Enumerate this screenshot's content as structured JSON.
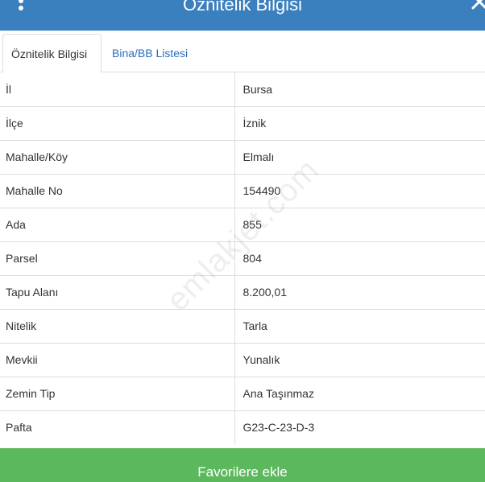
{
  "dialog": {
    "title": "Öznitelik Bilgisi",
    "menu_icon": "vertical-dots-icon",
    "close_icon": "close-icon"
  },
  "tabs": [
    {
      "label": "Öznitelik Bilgisi",
      "active": true
    },
    {
      "label": "Bina/BB Listesi",
      "active": false
    }
  ],
  "attributes": [
    {
      "key": "İl",
      "value": "Bursa"
    },
    {
      "key": "İlçe",
      "value": "İznik"
    },
    {
      "key": "Mahalle/Köy",
      "value": "Elmalı"
    },
    {
      "key": "Mahalle No",
      "value": "154490"
    },
    {
      "key": "Ada",
      "value": "855"
    },
    {
      "key": "Parsel",
      "value": "804"
    },
    {
      "key": "Tapu Alanı",
      "value": "8.200,01"
    },
    {
      "key": "Nitelik",
      "value": "Tarla"
    },
    {
      "key": "Mevkii",
      "value": "Yunalık"
    },
    {
      "key": "Zemin Tip",
      "value": "Ana Taşınmaz"
    },
    {
      "key": "Pafta",
      "value": "G23-C-23-D-3"
    }
  ],
  "watermark": "emlakjet.com",
  "actions": {
    "favorite_label": "Favorilere ekle"
  },
  "colors": {
    "header": "#3a7fbe",
    "tab_link": "#2a6ebb",
    "favorite_button": "#5cb85c"
  }
}
